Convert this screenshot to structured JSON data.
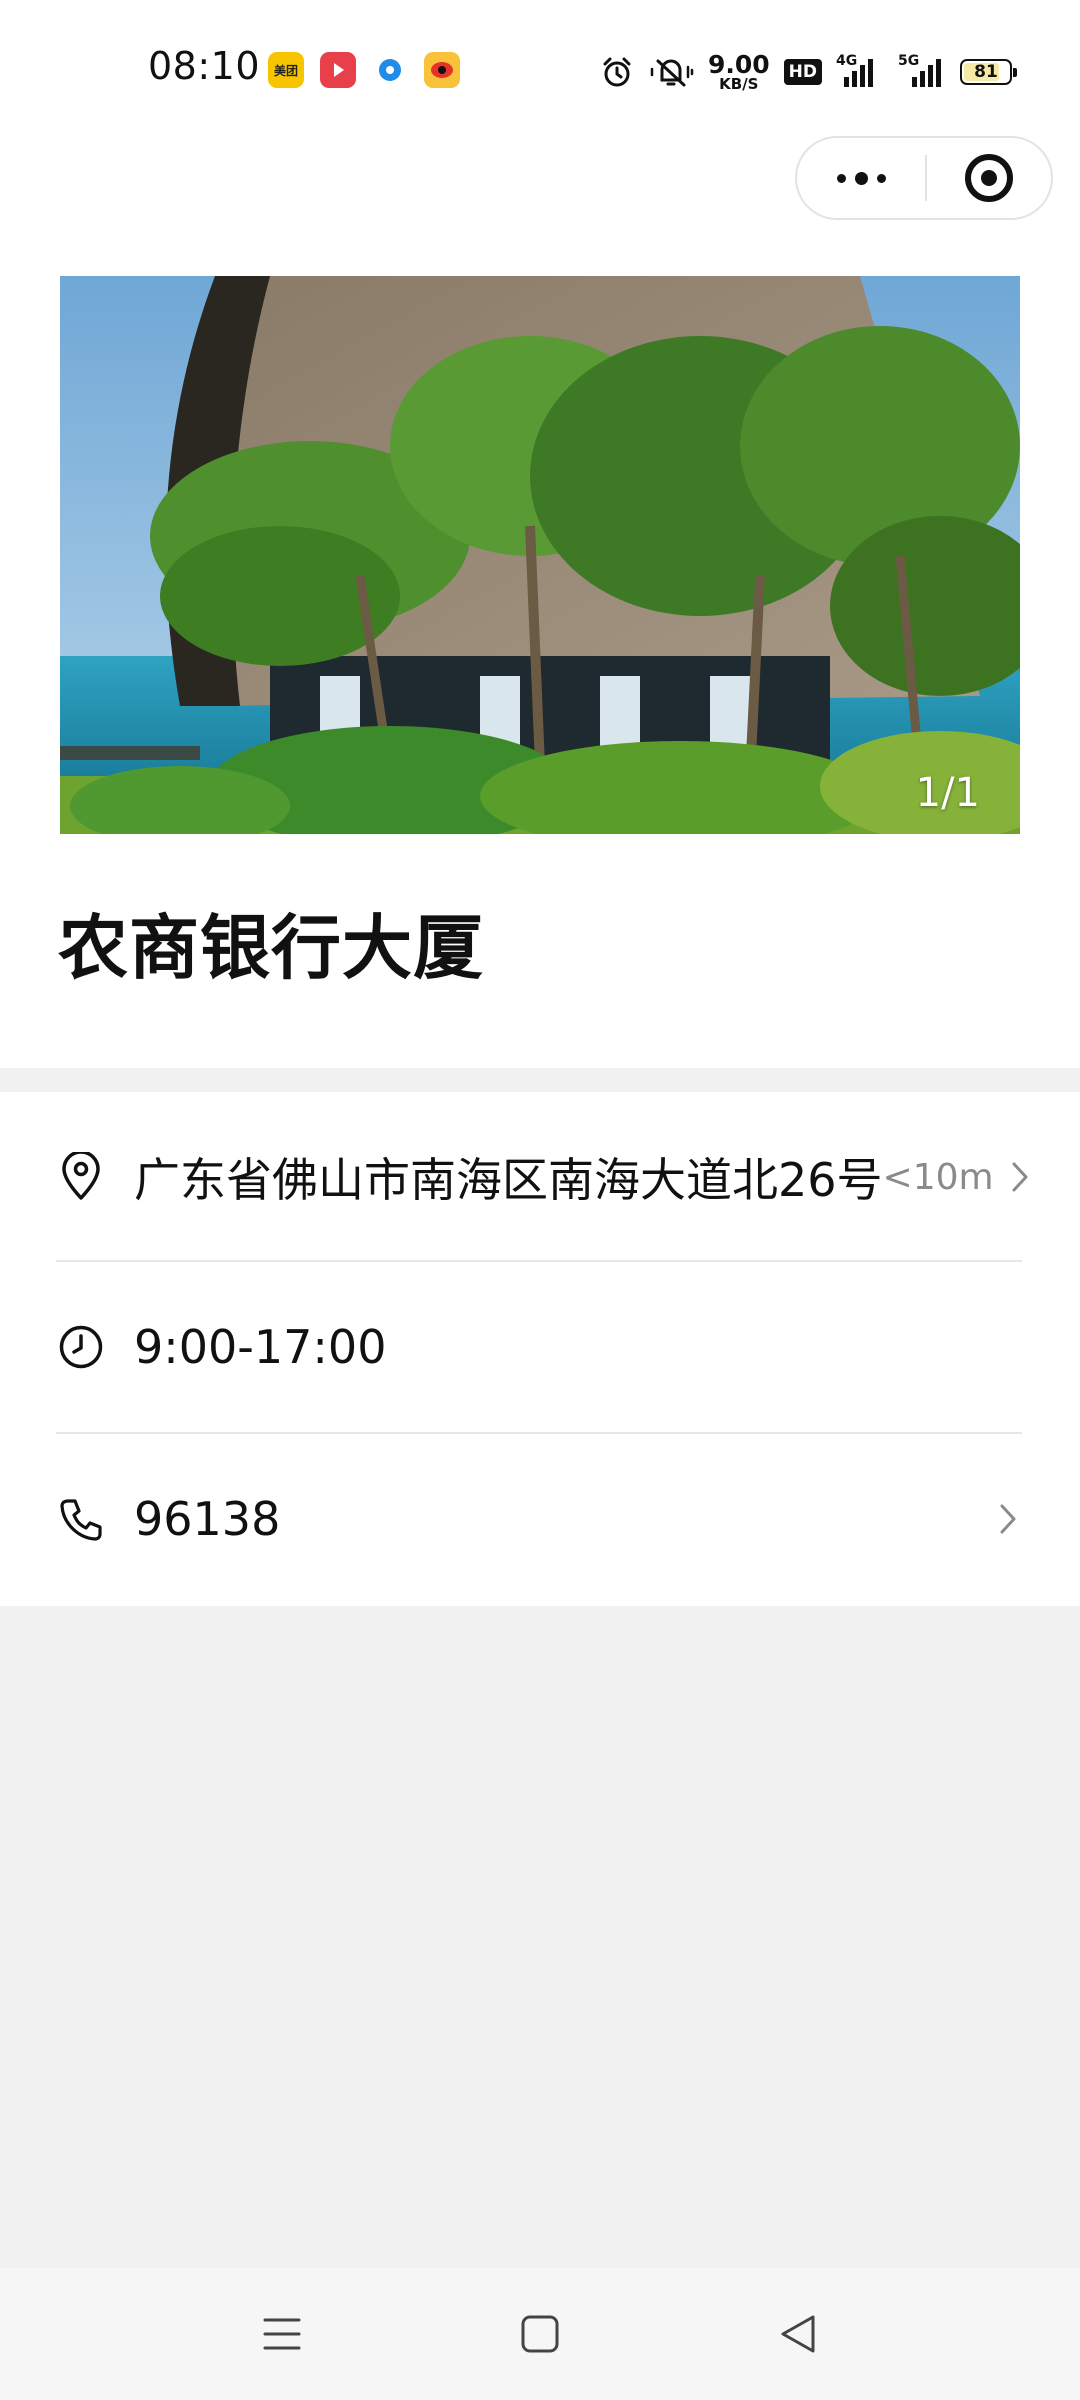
{
  "status_bar": {
    "time": "08:10",
    "app_icons": [
      "美团",
      "play",
      "dot",
      "weibo"
    ],
    "app_meituan_label": "美团",
    "net_speed_value": "9.00",
    "net_speed_unit": "KB/S",
    "hd_label": "HD",
    "signal_1_tag": "4G",
    "signal_2_tag": "5G",
    "battery_level": "81",
    "battery_fraction": 0.81
  },
  "capsule": {
    "more_icon": "more-dots-icon",
    "close_icon": "target-close-icon"
  },
  "place": {
    "photo_counter": "1/1",
    "title": "农商银行大厦"
  },
  "info": {
    "address": "广东省佛山市南海区南海大道北26号",
    "distance": "<10m",
    "hours": "9:00-17:00",
    "phone": "96138"
  },
  "nav": {
    "menu_icon": "menu-icon",
    "home_icon": "home-square-icon",
    "back_icon": "back-triangle-icon"
  },
  "colors": {
    "page_background": "#f1f1f1",
    "card_background": "#ffffff",
    "secondary_text": "#8a8a8a"
  }
}
